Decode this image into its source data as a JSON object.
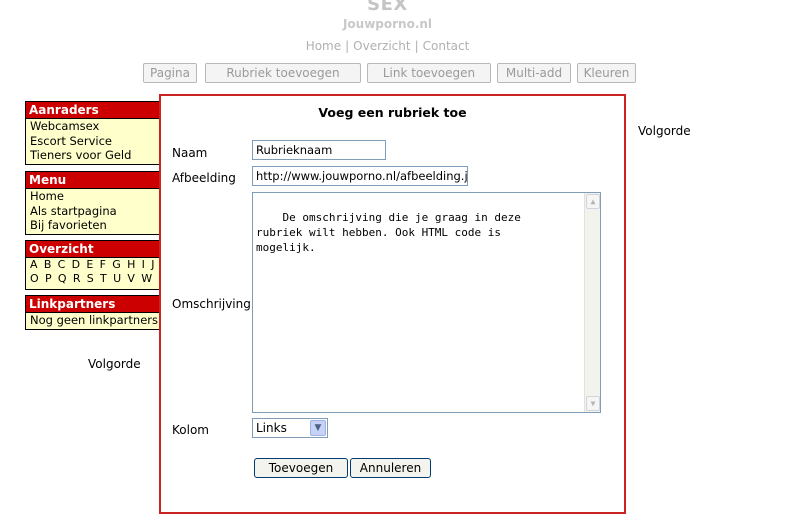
{
  "header": {
    "title": "SEX",
    "domain": "Jouwporno.nl",
    "nav": [
      "Home",
      "Overzicht",
      "Contact"
    ],
    "separator": "|"
  },
  "toolbar": {
    "buttons": [
      "Pagina",
      "Rubriek toevoegen",
      "Link toevoegen",
      "Multi-add",
      "Kleuren"
    ]
  },
  "sidebar": {
    "aanraders": {
      "title": "Aanraders",
      "items": [
        "Webcamsex",
        "Escort Service",
        "Tieners voor Geld"
      ]
    },
    "menu": {
      "title": "Menu",
      "items": [
        "Home",
        "Als startpagina",
        "Bij favorieten"
      ]
    },
    "overzicht": {
      "title": "Overzicht",
      "row1": "A B C D E F G H I J K",
      "row2": "O P Q R S T U V W X"
    },
    "linkpartners": {
      "title": "Linkpartners",
      "items": [
        "Nog geen linkpartners"
      ]
    },
    "volgorde": "Volgorde"
  },
  "right": {
    "volgorde": "Volgorde"
  },
  "form": {
    "title": "Voeg een rubriek toe",
    "naam_label": "Naam",
    "naam_value": "Rubrieknaam",
    "afbeelding_label": "Afbeelding",
    "afbeelding_value": "http://www.jouwporno.nl/afbeelding.jpg",
    "omschrijving_label": "Omschrijving",
    "omschrijving_value": "De omschrijving die je graag in deze\nrubriek wilt hebben. Ook HTML code is\nmogelijk.",
    "kolom_label": "Kolom",
    "kolom_value": "Links",
    "submit_label": "Toevoegen",
    "cancel_label": "Annuleren"
  },
  "colors": {
    "sidebar_header": "#cc0000",
    "sidebar_bg": "#ffffcc",
    "panel_border": "#cc2222"
  }
}
